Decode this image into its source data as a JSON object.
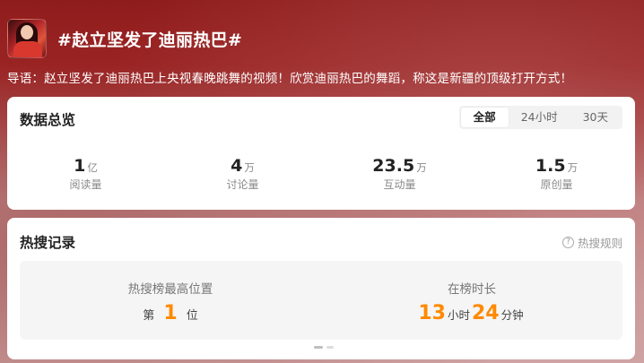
{
  "header": {
    "title": "#赵立坚发了迪丽热巴#",
    "avatar_icon": "topic-avatar-image"
  },
  "lead": "导语：赵立坚发了迪丽热巴上央视春晚跳舞的视频！欣赏迪丽热巴的舞蹈，称这是新疆的顶级打开方式！",
  "overview": {
    "title": "数据总览",
    "tabs": [
      {
        "label": "全部",
        "active": true
      },
      {
        "label": "24小时",
        "active": false
      },
      {
        "label": "30天",
        "active": false
      }
    ],
    "stats": [
      {
        "value": "1",
        "unit": "亿",
        "label": "阅读量"
      },
      {
        "value": "4",
        "unit": "万",
        "label": "讨论量"
      },
      {
        "value": "23.5",
        "unit": "万",
        "label": "互动量"
      },
      {
        "value": "1.5",
        "unit": "万",
        "label": "原创量"
      }
    ]
  },
  "hot": {
    "title": "热搜记录",
    "rule_label": "热搜规则",
    "rule_icon": "question-circle-icon",
    "peak": {
      "caption": "热搜榜最高位置",
      "prefix": "第",
      "rank": "1",
      "suffix": "位"
    },
    "duration": {
      "caption": "在榜时长",
      "hours": "13",
      "hours_unit": "小时",
      "minutes": "24",
      "minutes_unit": "分钟"
    }
  },
  "colors": {
    "accent_orange": "#ff8a00",
    "background_red": "#9b2424",
    "card": "#ffffff"
  }
}
